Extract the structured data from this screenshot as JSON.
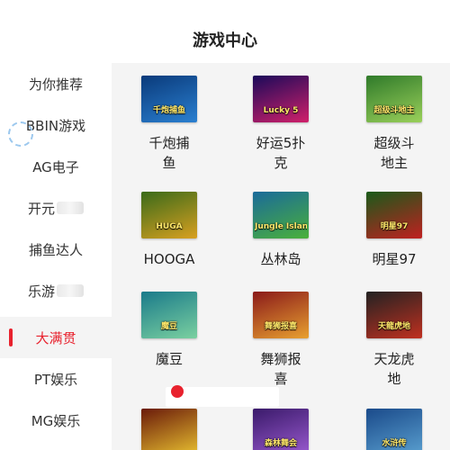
{
  "header": {
    "title": "游戏中心"
  },
  "sidebar": {
    "items": [
      {
        "label": "为你推荐"
      },
      {
        "label": "BBIN游戏"
      },
      {
        "label": "AG电子"
      },
      {
        "label": "开元"
      },
      {
        "label": "捕鱼达人"
      },
      {
        "label": "乐游"
      },
      {
        "label": "大满贯",
        "active": true
      },
      {
        "label": "PT娱乐"
      },
      {
        "label": "MG娱乐"
      }
    ]
  },
  "games": [
    {
      "name": "千炮捕鱼",
      "name_l1": "千炮捕",
      "name_l2": "鱼",
      "thumb_text": "千炮捕鱼",
      "colors": [
        "#0a3a7a",
        "#2a7fd0"
      ]
    },
    {
      "name": "好运5扑克",
      "name_l1": "好运5扑",
      "name_l2": "克",
      "thumb_text": "Lucky 5",
      "colors": [
        "#1a0a5a",
        "#d0206a"
      ]
    },
    {
      "name": "超级斗地主",
      "name_l1": "超级斗",
      "name_l2": "地主",
      "thumb_text": "超级斗地主",
      "colors": [
        "#2f7a2a",
        "#9ad05a"
      ]
    },
    {
      "name": "HOOGA",
      "name_l1": "HOOGA",
      "name_l2": "",
      "thumb_text": "HUGA",
      "colors": [
        "#3a6a1a",
        "#d8a020"
      ]
    },
    {
      "name": "丛林岛",
      "name_l1": "丛林岛",
      "name_l2": "",
      "thumb_text": "Jungle Island",
      "colors": [
        "#1a6a9a",
        "#4ab03a"
      ]
    },
    {
      "name": "明星97",
      "name_l1": "明星97",
      "name_l2": "",
      "thumb_text": "明星97",
      "colors": [
        "#1a5a1a",
        "#c02020"
      ]
    },
    {
      "name": "魔豆",
      "name_l1": "魔豆",
      "name_l2": "",
      "thumb_text": "魔豆",
      "colors": [
        "#1a7a8a",
        "#7ad0a0"
      ]
    },
    {
      "name": "舞狮报喜",
      "name_l1": "舞狮报",
      "name_l2": "喜",
      "thumb_text": "舞狮报喜",
      "colors": [
        "#8a1a1a",
        "#e8a030"
      ]
    },
    {
      "name": "天龙虎地",
      "name_l1": "天龙虎",
      "name_l2": "地",
      "thumb_text": "天龍虎地",
      "colors": [
        "#222222",
        "#c03020"
      ]
    },
    {
      "name": "",
      "name_l1": "",
      "name_l2": "",
      "thumb_text": "",
      "colors": [
        "#6a1a0a",
        "#e8c030"
      ]
    },
    {
      "name": "",
      "name_l1": "",
      "name_l2": "",
      "thumb_text": "森林舞会",
      "colors": [
        "#3a1a6a",
        "#9a5ad0"
      ]
    },
    {
      "name": "",
      "name_l1": "",
      "name_l2": "",
      "thumb_text": "水浒传",
      "colors": [
        "#1a4a8a",
        "#5aa0d0"
      ]
    }
  ],
  "banner": {
    "text": ""
  },
  "colors": {
    "accent": "#e8222e",
    "content_bg": "#f4f4f4"
  }
}
